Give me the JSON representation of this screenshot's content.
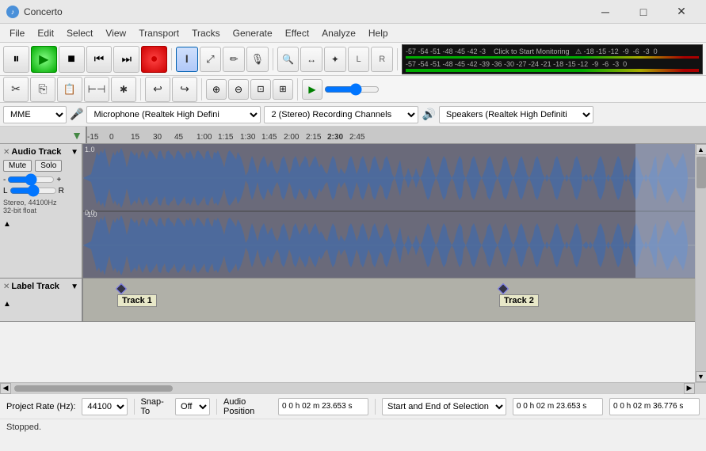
{
  "app": {
    "title": "Concerto",
    "icon": "♪"
  },
  "win_controls": {
    "minimize": "─",
    "maximize": "□",
    "close": "✕"
  },
  "menu": {
    "items": [
      "File",
      "Edit",
      "Select",
      "View",
      "Transport",
      "Tracks",
      "Generate",
      "Effect",
      "Analyze",
      "Help"
    ]
  },
  "transport": {
    "pause": "⏸",
    "play": "▶",
    "stop": "■",
    "skip_back": "⏮",
    "skip_fwd": "⏭",
    "record": "●"
  },
  "tools": {
    "select": "I",
    "envelope": "⤢",
    "draw": "✏",
    "mic": "🎤",
    "zoom_sel": "🔍",
    "time_shift": "↔",
    "multi": "✦",
    "gain_l": "L",
    "gain_r": "R"
  },
  "edit_tools": {
    "cut": "✂",
    "copy": "⎘",
    "paste": "📋",
    "trim": "⊢",
    "undo": "↩",
    "redo": "↪",
    "zoom_in": "⊕",
    "zoom_out": "⊖",
    "zoom_sel": "⊡",
    "zoom_fit": "⊞",
    "play_at": "▶",
    "loop": "↻"
  },
  "vu_meter": {
    "scale": "-57 -54 -51 -48 -45 -42 -3  Click to Start Monitoring  !1 -18 -15 -12  -9  -6  -3  0",
    "scale2": "-57 -54 -51 -48 -45 -42 -39 -36 -30 -27 -24 -21 -18 -15 -12  -9  -6  -3  0"
  },
  "devices": {
    "driver": "MME",
    "mic_icon": "🎤",
    "microphone": "Microphone (Realtek High Defini",
    "channels": "2 (Stereo) Recording Channels",
    "speaker_icon": "🔊",
    "speaker": "Speakers (Realtek High Definiti"
  },
  "timeline": {
    "markers": [
      "-15",
      "0",
      "15",
      "30",
      "45",
      "1:00",
      "1:15",
      "1:30",
      "1:45",
      "2:00",
      "2:15",
      "2:30",
      "2:45"
    ]
  },
  "audio_track": {
    "close": "✕",
    "name": "Audio Track",
    "dropdown": "▼",
    "mute": "Mute",
    "solo": "Solo",
    "gain_minus": "-",
    "gain_plus": "+",
    "pan_l": "L",
    "pan_r": "R",
    "info": "Stereo, 44100Hz\n32-bit float",
    "expand": "▲",
    "scale_top": "1.0",
    "scale_mid": "0.0",
    "scale_bot": "-1.0",
    "scale_top2": "1.0",
    "scale_mid2": "0.0",
    "scale_bot2": "-1.0"
  },
  "label_track": {
    "close": "✕",
    "name": "Label Track",
    "dropdown": "▼",
    "expand": "▲",
    "track1_label": "Track 1",
    "track2_label": "Track 2"
  },
  "bottom": {
    "project_rate_label": "Project Rate (Hz):",
    "project_rate_value": "44100",
    "snap_to_label": "Snap-To",
    "snap_to_value": "Off",
    "audio_position_label": "Audio Position",
    "selection_mode": "Start and End of Selection",
    "pos1": "0 0 h 02 m 23.653 s",
    "pos2": "0 0 h 02 m 23.653 s",
    "pos3": "0 0 h 02 m 36.776 s",
    "status": "Stopped."
  }
}
